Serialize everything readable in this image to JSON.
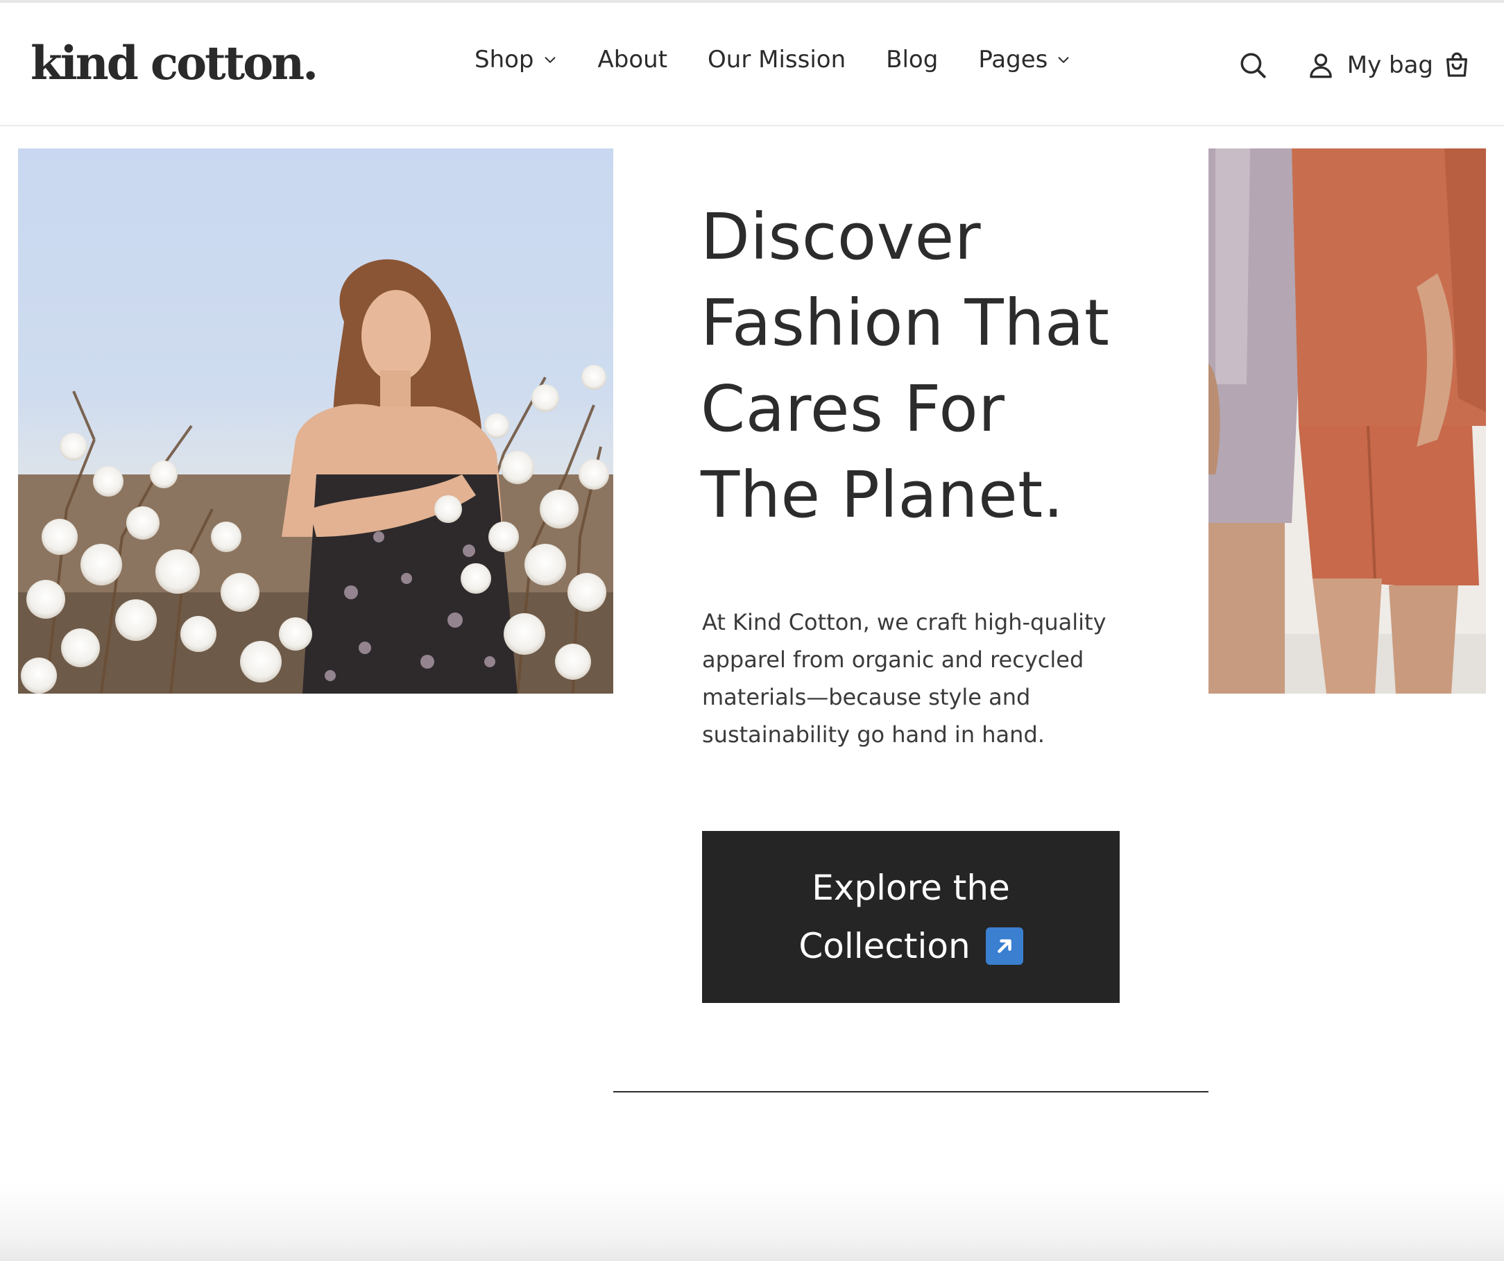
{
  "brand": {
    "logo_text": "kind cotton."
  },
  "nav": {
    "items": [
      {
        "label": "Shop",
        "has_dropdown": true
      },
      {
        "label": "About",
        "has_dropdown": false
      },
      {
        "label": "Our Mission",
        "has_dropdown": false
      },
      {
        "label": "Blog",
        "has_dropdown": false
      },
      {
        "label": "Pages",
        "has_dropdown": true
      }
    ]
  },
  "header_actions": {
    "search_icon": "search-icon",
    "account_icon": "user-icon",
    "bag_label": "My bag",
    "bag_icon": "shopping-bag-icon"
  },
  "hero": {
    "title": "Discover Fashion That Cares For The Planet.",
    "description": "At Kind Cotton, we craft high-quality apparel from organic and recycled materials—because style and sustainability go hand in hand.",
    "cta_line1": "Explore the",
    "cta_line2": "Collection",
    "cta_icon": "up-right-arrow-icon"
  },
  "colors": {
    "text": "#2b2b2b",
    "cta_bg": "#252525",
    "cta_text": "#ffffff",
    "arrow_badge": "#3a7fd0"
  }
}
